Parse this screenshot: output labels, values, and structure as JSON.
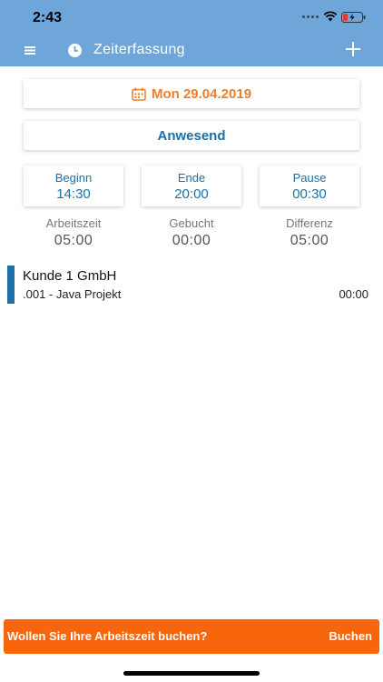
{
  "status_bar": {
    "time": "2:43"
  },
  "nav": {
    "title": "Zeiterfassung",
    "menu_icon": "hamburger-menu-icon",
    "clock_icon": "clock-icon",
    "add_icon": "plus-icon"
  },
  "date": {
    "label": "Mon 29.04.2019",
    "icon": "calendar-icon"
  },
  "presence": {
    "label": "Anwesend"
  },
  "times": {
    "begin": {
      "label": "Beginn",
      "value": "14:30"
    },
    "end": {
      "label": "Ende",
      "value": "20:00"
    },
    "pause": {
      "label": "Pause",
      "value": "00:30"
    }
  },
  "summary": {
    "worktime": {
      "label": "Arbeitszeit",
      "value": "05:00"
    },
    "booked": {
      "label": "Gebucht",
      "value": "00:00"
    },
    "difference": {
      "label": "Differenz",
      "value": "05:00"
    }
  },
  "entries": [
    {
      "customer": "Kunde 1 GmbH",
      "project": ".001 - Java Projekt",
      "duration": "00:00"
    }
  ],
  "book_prompt": {
    "question": "Wollen Sie Ihre Arbeitszeit buchen?",
    "button": "Buchen"
  },
  "colors": {
    "header": "#6fa6da",
    "accent_orange": "#f07d2a",
    "accent_blue": "#1d6fa5",
    "book_bar": "#f7650d"
  }
}
